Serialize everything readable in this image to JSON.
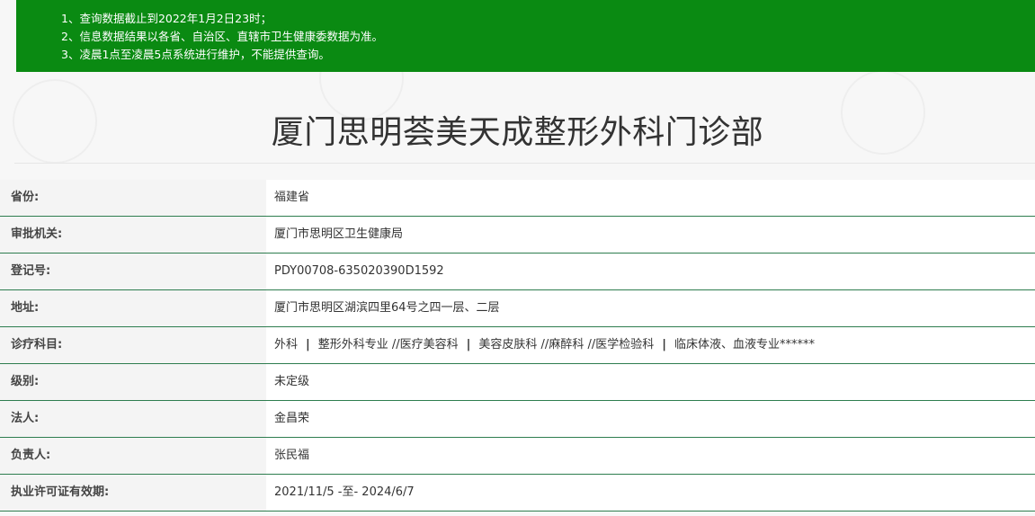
{
  "notice": {
    "lines": [
      "1、查询数据截止到2022年1月2日23时；",
      "2、信息数据结果以各省、自治区、直辖市卫生健康委数据为准。",
      "3、凌晨1点至凌晨5点系统进行维护，不能提供查询。"
    ],
    "background_color": "#0a8a12"
  },
  "title": "厦门思明荟美天成整形外科门诊部",
  "info": {
    "province": {
      "label": "省份:",
      "value": "福建省"
    },
    "authority": {
      "label": "审批机关:",
      "value": "厦门市思明区卫生健康局"
    },
    "registration": {
      "label": "登记号:",
      "value": "PDY00708-635020390D1592"
    },
    "address": {
      "label": "地址:",
      "value": "厦门市思明区湖滨四里64号之四一层、二层"
    },
    "departments": {
      "label": "诊疗科目:",
      "items": [
        "外科",
        "整形外科专业 //医疗美容科",
        "美容皮肤科 //麻醉科 //医学检验科",
        "临床体液、血液专业******"
      ],
      "separator": "|"
    },
    "level": {
      "label": "级别:",
      "value": "未定级"
    },
    "legal_person": {
      "label": "法人:",
      "value": "金昌荣"
    },
    "person_in_charge": {
      "label": "负责人:",
      "value": "张民福"
    },
    "license_validity": {
      "label": "执业许可证有效期:",
      "value": "2021/11/5 -至- 2024/6/7"
    }
  },
  "colors": {
    "row_border": "#2e7d4f",
    "label_background": "#f4f4f4",
    "value_background": "#ffffff"
  }
}
